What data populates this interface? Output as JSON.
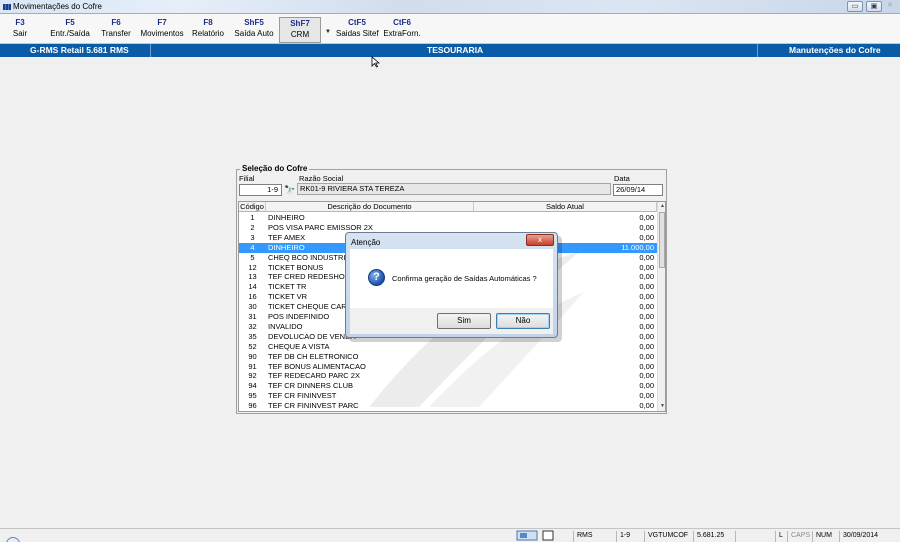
{
  "window": {
    "title": "Movimentações do Cofre"
  },
  "toolbar": {
    "buttons": [
      {
        "key": "F3",
        "label": "Sair"
      },
      {
        "key": "F5",
        "label": "Entr./Saída"
      },
      {
        "key": "F6",
        "label": "Transfer"
      },
      {
        "key": "F7",
        "label": "Movimentos"
      },
      {
        "key": "F8",
        "label": "Relatório"
      },
      {
        "key": "ShF5",
        "label": "Saída Auto"
      },
      {
        "key": "ShF7",
        "label": "CRM"
      },
      {
        "key": "CtF5",
        "label": "Saidas Sitef"
      },
      {
        "key": "CtF6",
        "label": "ExtraForn."
      }
    ]
  },
  "header": {
    "left": "G-RMS Retail 5.681 RMS",
    "center": "TESOURARIA",
    "right": "Manutenções do Cofre"
  },
  "panel": {
    "legend": "Seleção do Cofre",
    "filial_label": "Filial",
    "razao_label": "Razão Social",
    "data_label": "Data",
    "filial_value": "1-9",
    "razao_value": "RK01-9 RIVIERA STA TEREZA",
    "data_value": "26/09/14"
  },
  "grid": {
    "columns": [
      "Código",
      "Descrição do Documento",
      "Saldo Atual"
    ],
    "rows": [
      {
        "codigo": "1",
        "descricao": "DINHEIRO",
        "saldo": "0,00"
      },
      {
        "codigo": "2",
        "descricao": "POS VISA PARC EMISSOR  2X",
        "saldo": "0,00"
      },
      {
        "codigo": "3",
        "descricao": "TEF AMEX",
        "saldo": "0,00"
      },
      {
        "codigo": "4",
        "descricao": "DINHEIRO",
        "saldo": "11.000,00",
        "selected": true
      },
      {
        "codigo": "5",
        "descricao": "CHEQ BCO INDUSTRIAL",
        "saldo": "0,00"
      },
      {
        "codigo": "12",
        "descricao": "TICKET BONUS",
        "saldo": "0,00"
      },
      {
        "codigo": "13",
        "descricao": "TEF CRED REDESHOP C",
        "saldo": "0,00"
      },
      {
        "codigo": "14",
        "descricao": "TICKET TR",
        "saldo": "0,00"
      },
      {
        "codigo": "16",
        "descricao": "TICKET VR",
        "saldo": "0,00"
      },
      {
        "codigo": "30",
        "descricao": "TICKET CHEQUE CARDA",
        "saldo": "0,00"
      },
      {
        "codigo": "31",
        "descricao": "POS INDEFINIDO",
        "saldo": "0,00"
      },
      {
        "codigo": "32",
        "descricao": "INVALIDO",
        "saldo": "0,00"
      },
      {
        "codigo": "35",
        "descricao": "DEVOLUCAO DE VENDA",
        "saldo": "0,00"
      },
      {
        "codigo": "52",
        "descricao": "CHEQUE A VISTA",
        "saldo": "0,00"
      },
      {
        "codigo": "90",
        "descricao": "TEF DB CH ELETRONICO",
        "saldo": "0,00"
      },
      {
        "codigo": "91",
        "descricao": "TEF BONUS ALIMENTACAO",
        "saldo": "0,00"
      },
      {
        "codigo": "92",
        "descricao": "TEF REDECARD PARC 2X",
        "saldo": "0,00"
      },
      {
        "codigo": "94",
        "descricao": "TEF CR DINNERS CLUB",
        "saldo": "0,00"
      },
      {
        "codigo": "95",
        "descricao": "TEF CR FININVEST",
        "saldo": "0,00"
      },
      {
        "codigo": "96",
        "descricao": "TEF CR FININVEST PARC",
        "saldo": "0,00"
      }
    ]
  },
  "dialog": {
    "title": "Atenção",
    "close": "x",
    "message": "Confirma geração de Saídas Automáticas ?",
    "yes": "Sim",
    "no": "Não"
  },
  "statusbar": {
    "cells": [
      "RMS",
      "1-9",
      "VGTUMCOF",
      "5.681.25",
      "",
      "L",
      "CAPS",
      "NUM",
      "30/09/2014"
    ]
  },
  "colors": {
    "header_bg": "#0a5ca8",
    "selection": "#3399ff",
    "toolbar_key": "#1b2d8c"
  }
}
